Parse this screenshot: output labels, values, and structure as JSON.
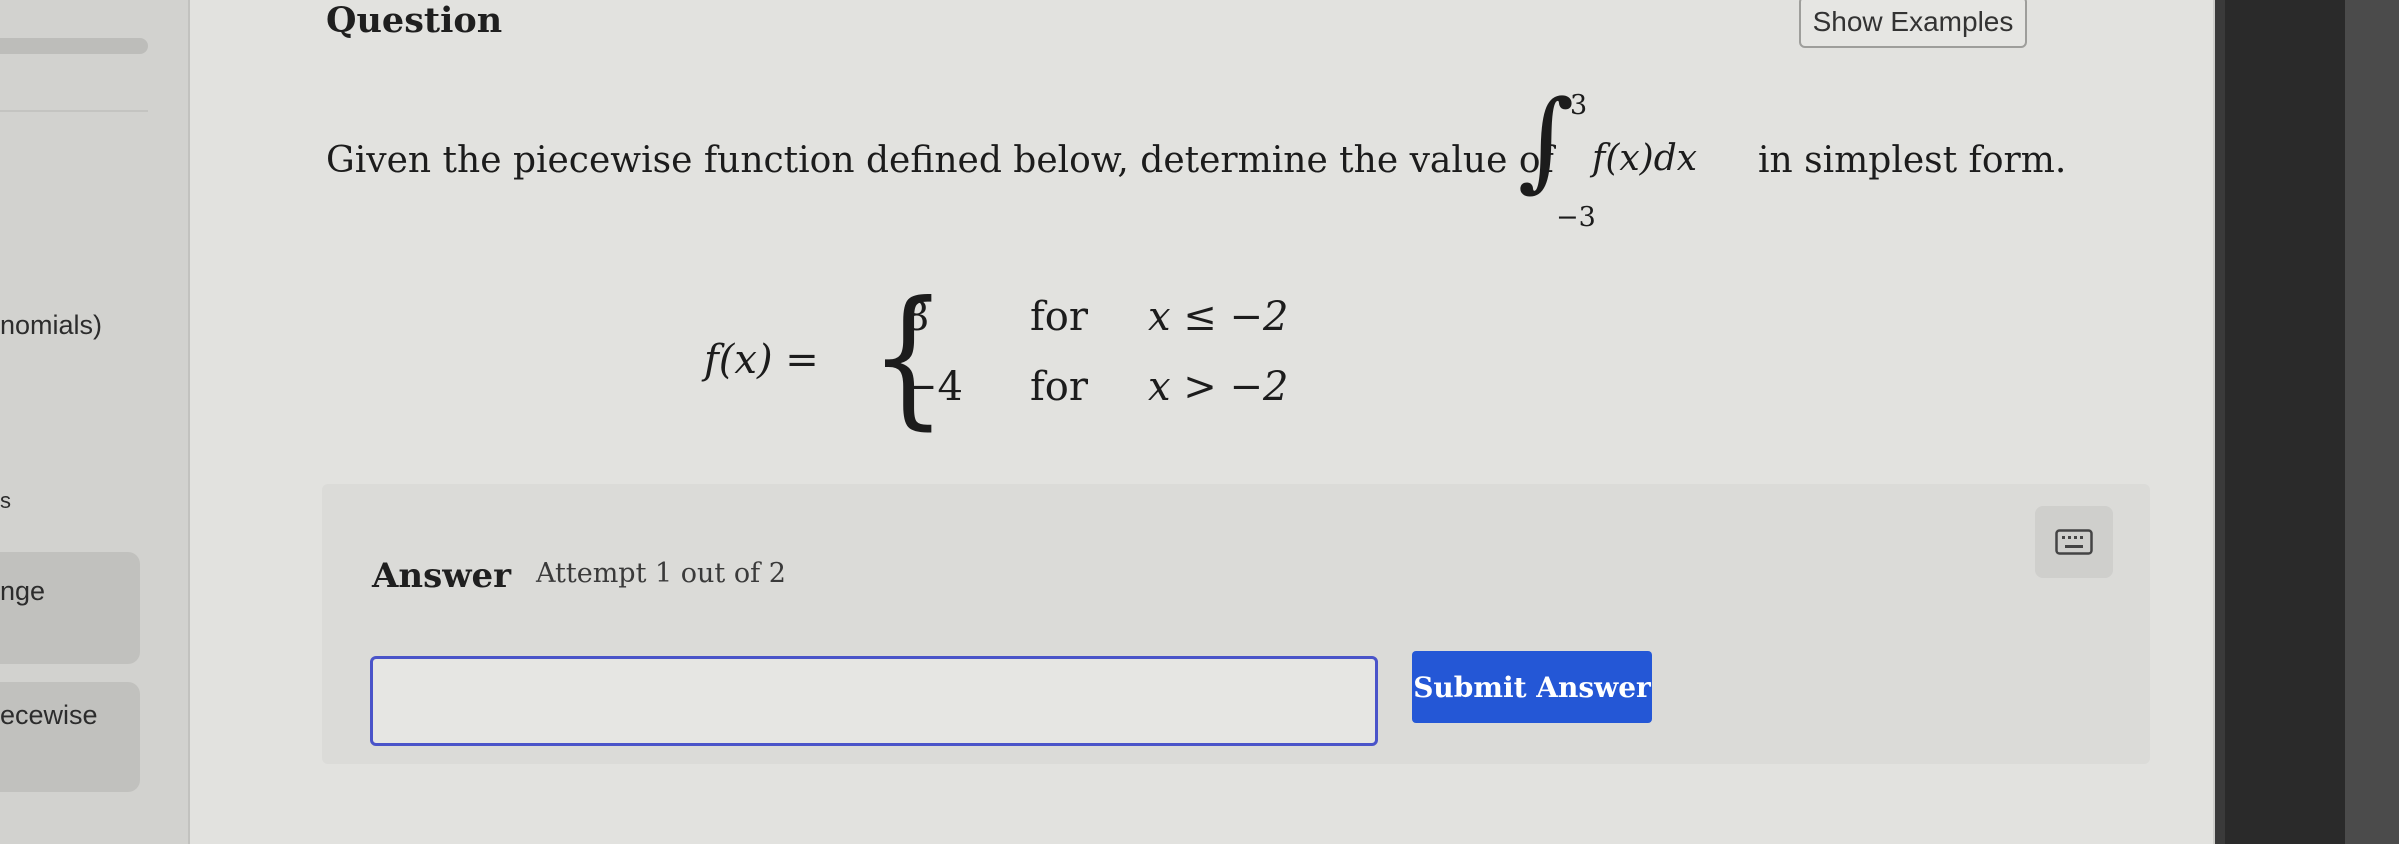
{
  "sidebar": {
    "items": [
      {
        "label": "nomials)"
      },
      {
        "label": "s"
      },
      {
        "label": "nge"
      },
      {
        "label": "ecewise"
      }
    ]
  },
  "question": {
    "header": "Question",
    "show_examples": "Show Examples",
    "prompt_before": "Given the piecewise function defined below, determine the value of",
    "integral_sign": "∫",
    "integral_upper": "3",
    "integral_lower": "−3",
    "integral_body": "f(x)dx",
    "prompt_after": "in simplest form.",
    "function_lhs": "f(x) =",
    "pieces": [
      {
        "value": "8",
        "word": "for",
        "condition": "x ≤ −2"
      },
      {
        "value": "−4",
        "word": "for",
        "condition": "x > −2"
      }
    ]
  },
  "answer": {
    "title": "Answer",
    "attempt": "Attempt 1 out of 2",
    "input_value": "",
    "submit_label": "Submit Answer",
    "keyboard_icon": "keyboard-icon"
  },
  "colors": {
    "submit_bg": "#2457d6",
    "input_border": "#4a54c9"
  }
}
